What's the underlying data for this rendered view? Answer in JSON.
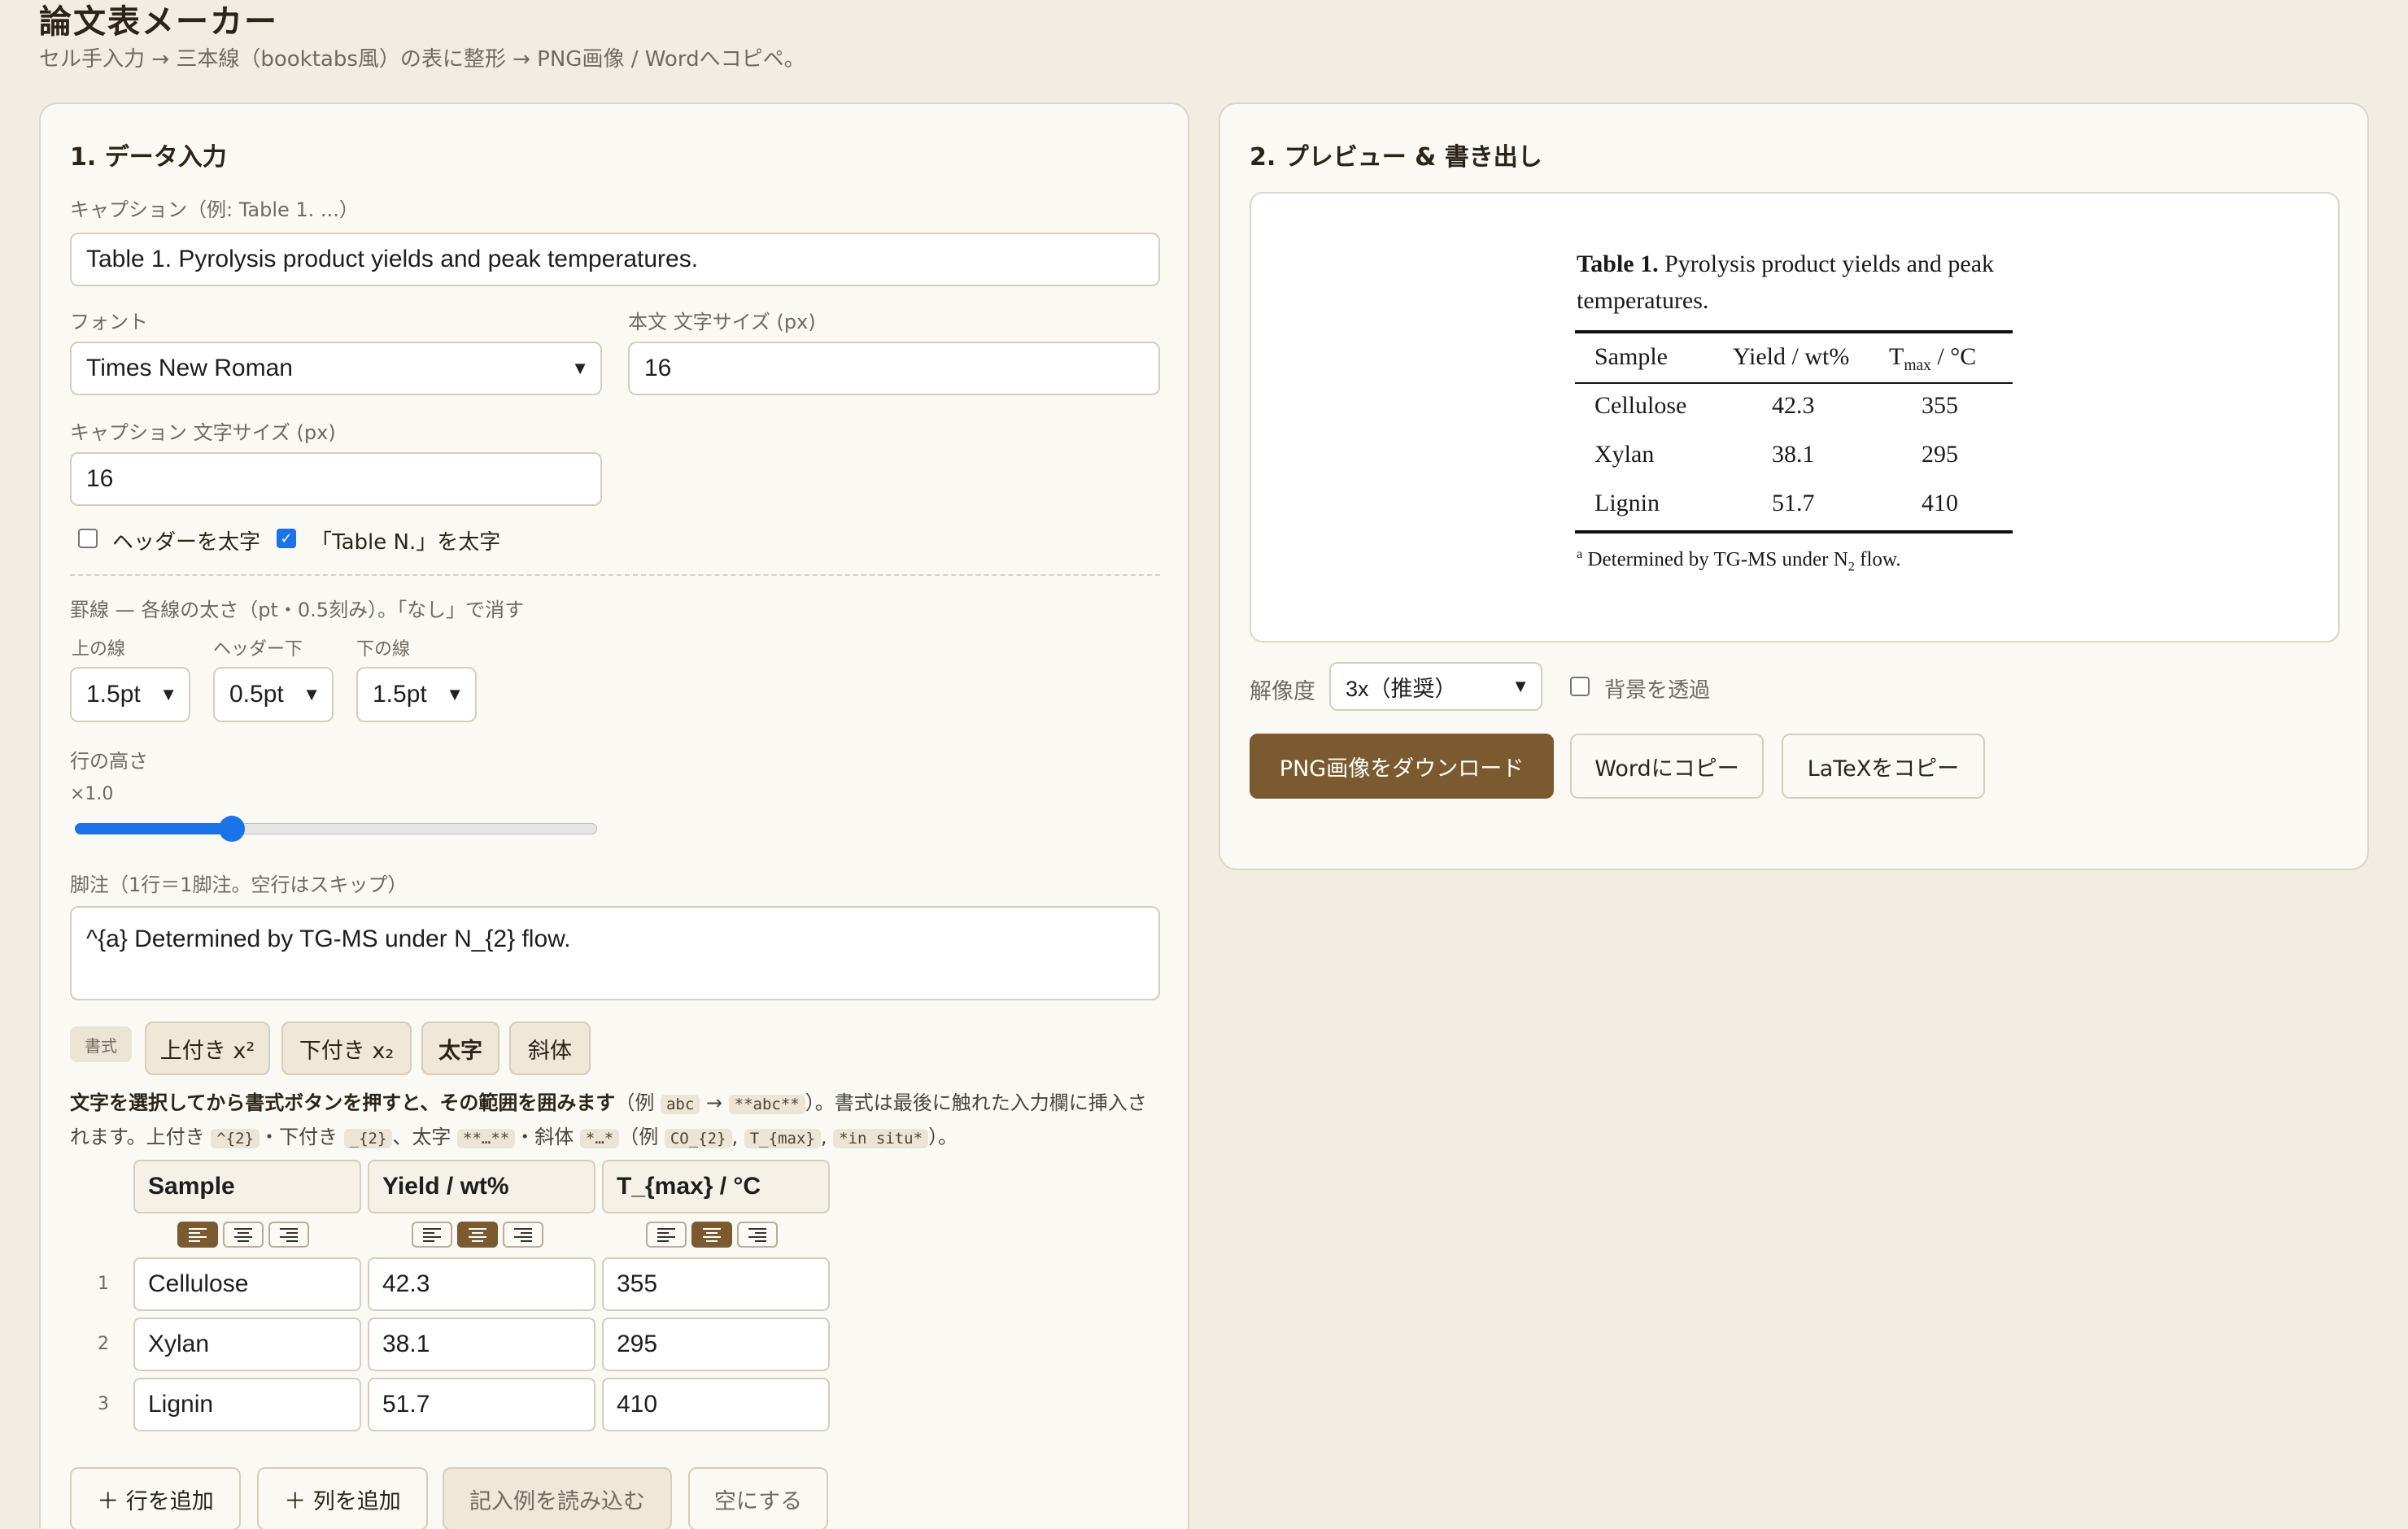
{
  "app": {
    "title": "論文表メーカー",
    "subtitle": "セル手入力 → 三本線（booktabs風）の表に整形 → PNG画像 / Wordへコピペ。"
  },
  "input_panel": {
    "title": "1. データ入力",
    "caption_label": "キャプション（例: Table 1. ...）",
    "caption_value": "Table 1. Pyrolysis product yields and peak temperatures.",
    "font_label": "フォント",
    "font_value": "Times New Roman",
    "body_size_label": "本文 文字サイズ (px)",
    "body_size_value": "16",
    "caption_size_label": "キャプション 文字サイズ (px)",
    "caption_size_value": "16",
    "bold_header_label": "ヘッダーを太字",
    "bold_header_checked": false,
    "bold_table_n_label": "「Table N.」を太字",
    "bold_table_n_checked": true,
    "rules_label": "罫線 — 各線の太さ（pt・0.5刻み）。「なし」で消す",
    "top_rule_label": "上の線",
    "top_rule_value": "1.5pt",
    "mid_rule_label": "ヘッダー下",
    "mid_rule_value": "0.5pt",
    "bottom_rule_label": "下の線",
    "bottom_rule_value": "1.5pt",
    "row_height_label": "行の高さ",
    "row_height_value": "×1.0",
    "row_height_fraction": 0.3,
    "footnote_label": "脚注（1行＝1脚注。空行はスキップ）",
    "footnote_value": "^{a} Determined by TG-MS under N_{2} flow.",
    "format_tag": "書式",
    "format_buttons": [
      "上付き x²",
      "下付き x₂",
      "太字",
      "斜体"
    ],
    "help": {
      "p1_bold": "文字を選択してから書式ボタンを押すと、その範囲を囲みます",
      "p1_open": "（例 ",
      "code_abc": "abc",
      "arrow": " → ",
      "code_bold_abc": "**abc**",
      "p1_close": "）。書式は最後に触れた入力欄に挿入されます。上付き ",
      "code_sup": "^{2}",
      "sep1": "・下付き ",
      "code_sub": "_{2}",
      "sep2": "、太字 ",
      "code_bold": "**…**",
      "sep3": "・斜体 ",
      "code_italic": "*…*",
      "ex_open": "（例 ",
      "code_co2": "CO_{2}",
      "comma1": ", ",
      "code_tmax": "T_{max}",
      "comma2": ", ",
      "code_insitu": "*in situ*",
      "ex_close": "）。"
    },
    "table": {
      "headers": [
        "Sample",
        "Yield / wt%",
        "T_{max} / °C"
      ],
      "alignments": [
        "left",
        "center",
        "center"
      ],
      "rows": [
        {
          "num": "1",
          "cells": [
            "Cellulose",
            "42.3",
            "355"
          ]
        },
        {
          "num": "2",
          "cells": [
            "Xylan",
            "38.1",
            "295"
          ]
        },
        {
          "num": "3",
          "cells": [
            "Lignin",
            "51.7",
            "410"
          ]
        }
      ]
    },
    "actions": {
      "add_row": "＋ 行を追加",
      "add_col": "＋ 列を追加",
      "load_example": "記入例を読み込む",
      "clear": "空にする"
    }
  },
  "preview_panel": {
    "title": "2. プレビュー & 書き出し",
    "preview": {
      "caption_bold": "Table 1.",
      "caption_text": " Pyrolysis product yields and peak temperatures.",
      "headers": [
        "Sample",
        "Yield / wt%",
        "T",
        "max",
        " / °C"
      ],
      "rows": [
        [
          "Cellulose",
          "42.3",
          "355"
        ],
        [
          "Xylan",
          "38.1",
          "295"
        ],
        [
          "Lignin",
          "51.7",
          "410"
        ]
      ],
      "footnote_sup": "a",
      "footnote_text": " Determined by TG-MS under N",
      "footnote_sub": "2",
      "footnote_end": " flow."
    },
    "resolution_label": "解像度",
    "resolution_value": "3x（推奨）",
    "transparent_label": "背景を透過",
    "transparent_checked": false,
    "download_png": "PNG画像をダウンロード",
    "copy_word": "Wordにコピー",
    "copy_latex": "LaTeXをコピー"
  },
  "colors": {
    "background": "#f1ede3",
    "accent_brown": "#7a5a2e",
    "slider_blue": "#1a73e8"
  }
}
